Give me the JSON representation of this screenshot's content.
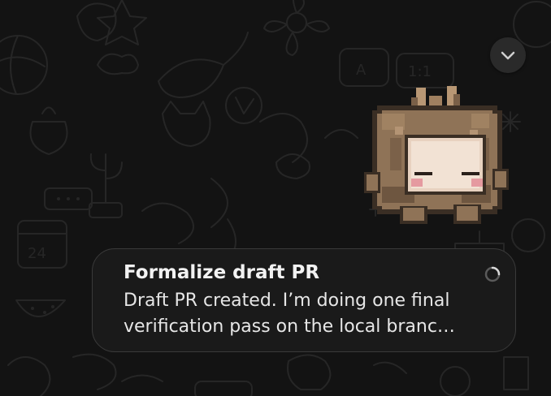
{
  "notification": {
    "title": "Formalize draft PR",
    "body": "Draft PR created. I’m doing one final verification pass on the local branc…",
    "status_icon": "loading-spinner-icon"
  },
  "scroll_button": {
    "icon": "chevron-down-icon"
  },
  "sticker": {
    "icon": "pixel-creature-sticker"
  },
  "background": {
    "pattern": "chat-doodle-wallpaper",
    "base_color": "#131313",
    "doodle_color": "#262626",
    "doodle_texts": [
      "24",
      "1:1",
      "A"
    ]
  },
  "colors": {
    "bubble_bg": "#1a1a1a",
    "bubble_border": "#3a3a3a",
    "text_primary": "#f2f2f2",
    "text_secondary": "#e6e6e6"
  }
}
